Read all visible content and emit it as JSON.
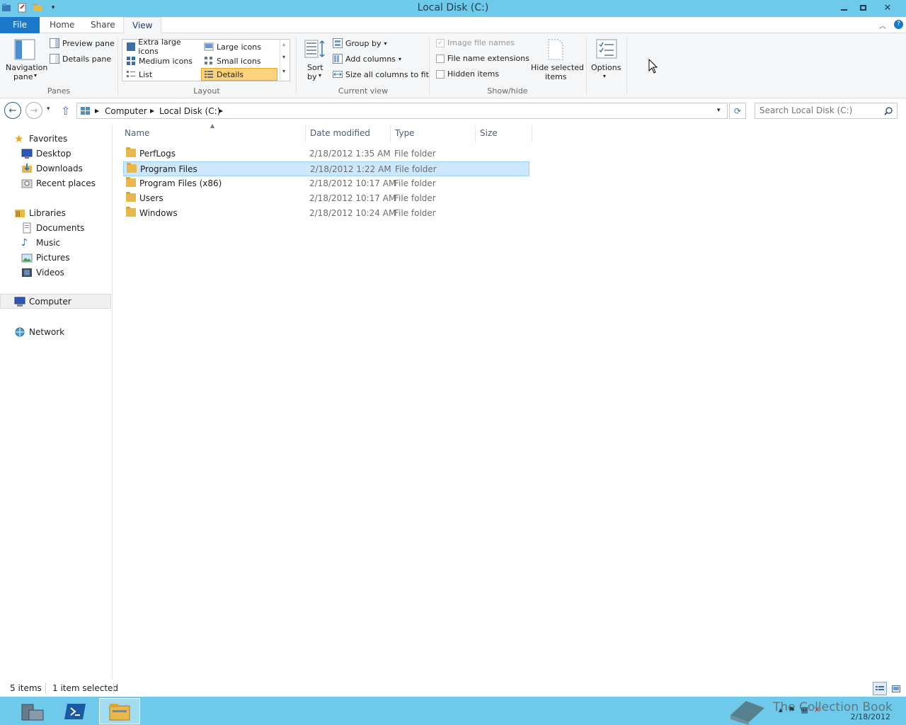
{
  "window": {
    "title": "Local Disk (C:)"
  },
  "tabs": {
    "file": "File",
    "home": "Home",
    "share": "Share",
    "view": "View"
  },
  "ribbon": {
    "panes": {
      "navigation_pane_1": "Navigation",
      "navigation_pane_2": "pane",
      "preview_pane": "Preview pane",
      "details_pane": "Details pane",
      "label": "Panes"
    },
    "layout": {
      "extra_large": "Extra large icons",
      "large": "Large icons",
      "medium": "Medium icons",
      "small": "Small icons",
      "list": "List",
      "details": "Details",
      "label": "Layout"
    },
    "current_view": {
      "sort_by_1": "Sort",
      "sort_by_2": "by",
      "group_by": "Group by",
      "add_columns": "Add columns",
      "size_all": "Size all columns to fit",
      "label": "Current view"
    },
    "show_hide": {
      "image_file_names": "Image file names",
      "file_name_extensions": "File name extensions",
      "hidden_items": "Hidden items",
      "hide_selected_1": "Hide selected",
      "hide_selected_2": "items",
      "label": "Show/hide"
    },
    "options": "Options"
  },
  "address": {
    "crumbs": [
      "Computer",
      "Local Disk (C:)"
    ],
    "search_placeholder": "Search Local Disk (C:)"
  },
  "navpane": {
    "favorites": "Favorites",
    "desktop": "Desktop",
    "downloads": "Downloads",
    "recent": "Recent places",
    "libraries": "Libraries",
    "documents": "Documents",
    "music": "Music",
    "pictures": "Pictures",
    "videos": "Videos",
    "computer": "Computer",
    "network": "Network"
  },
  "columns": {
    "name": "Name",
    "date": "Date modified",
    "type": "Type",
    "size": "Size"
  },
  "files": [
    {
      "name": "PerfLogs",
      "date": "2/18/2012 1:35 AM",
      "type": "File folder",
      "size": ""
    },
    {
      "name": "Program Files",
      "date": "2/18/2012 1:22 AM",
      "type": "File folder",
      "size": ""
    },
    {
      "name": "Program Files (x86)",
      "date": "2/18/2012 10:17 AM",
      "type": "File folder",
      "size": ""
    },
    {
      "name": "Users",
      "date": "2/18/2012 10:17 AM",
      "type": "File folder",
      "size": ""
    },
    {
      "name": "Windows",
      "date": "2/18/2012 10:24 AM",
      "type": "File folder",
      "size": ""
    }
  ],
  "status": {
    "count": "5 items",
    "selected": "1 item selected"
  },
  "taskbar": {
    "date": "2/18/2012",
    "watermark": "The Collection Book"
  },
  "colors": {
    "titlebar": "#6fc9ea",
    "file_tab": "#1979ca",
    "selection": "#cce8ff",
    "layout_selected": "#fdd27c"
  }
}
